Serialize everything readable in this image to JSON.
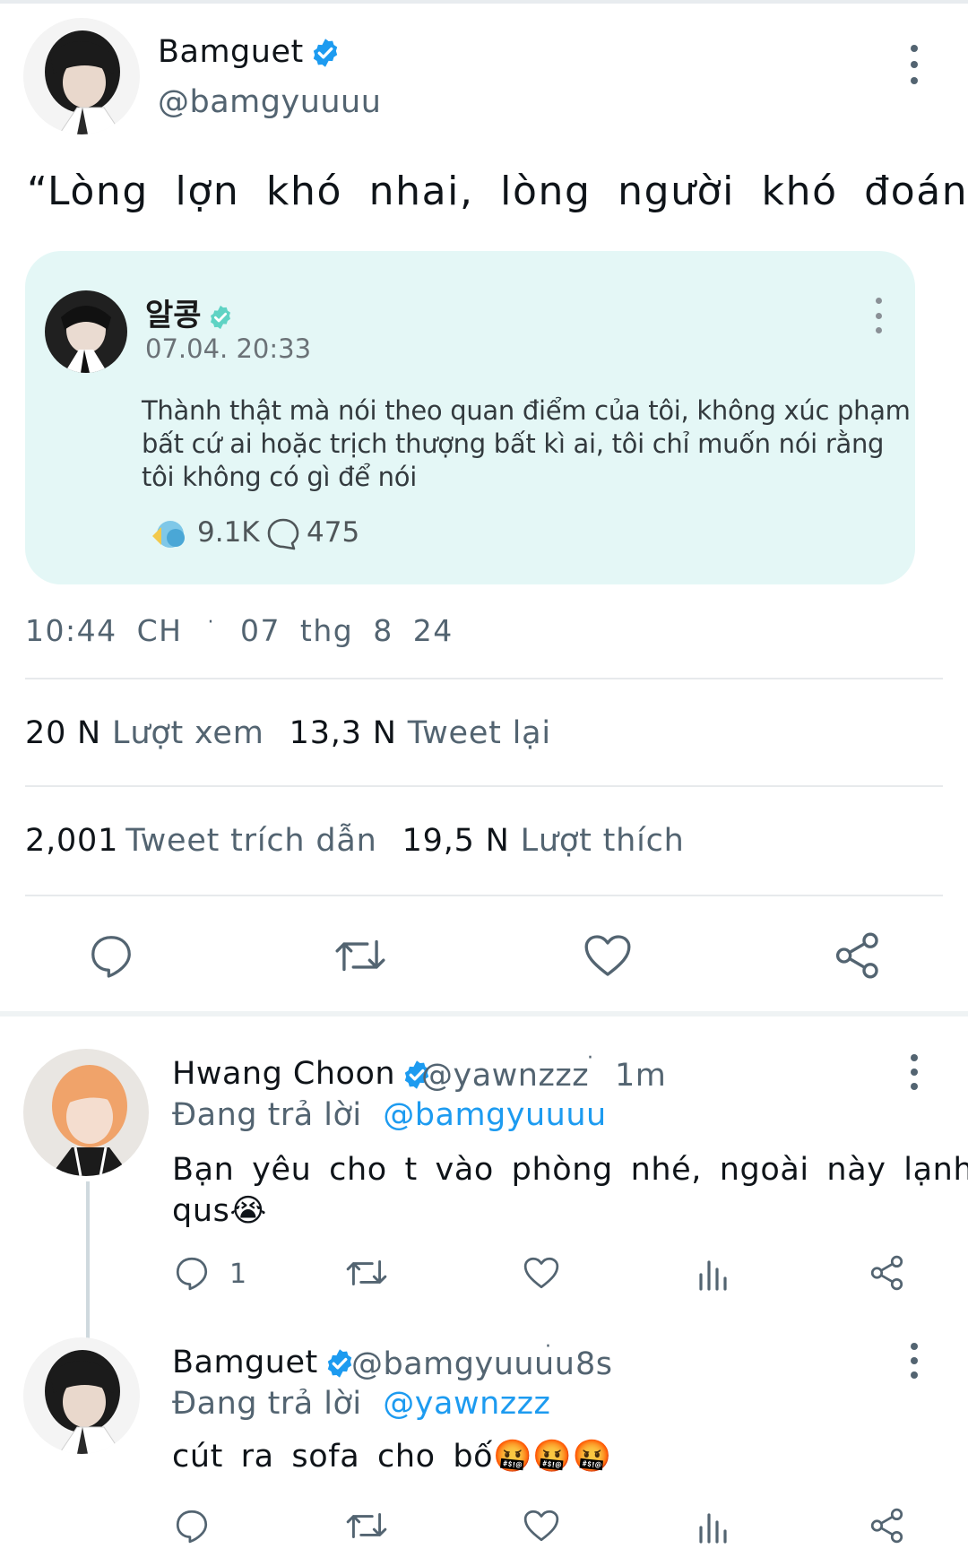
{
  "main_tweet": {
    "author_name": "Bamguet",
    "author_handle": "@bamgyuuuu",
    "text": "“Lòng lợn khó nhai, lòng người khó đoán”",
    "quoted": {
      "author_name": "알콩",
      "date": "07.04. 20:33",
      "body": "Thành thật mà nói theo quan điểm của tôi, không xúc phạm bất cứ ai hoặc trịch thượng bất kì ai, tôi chỉ muốn nói rằng tôi không có gì để nói",
      "likes": "9.1K",
      "comments": "475"
    },
    "time": "10:44 CH",
    "date": "07 thg 8 24",
    "views_count": "20 N",
    "views_label": "Lượt xem",
    "retweets_count": "13,3 N",
    "retweets_label": "Tweet lại",
    "quotes_count": "2,001",
    "quotes_label": "Tweet trích dẫn",
    "likes_count": "19,5 N",
    "likes_label": "Lượt thích"
  },
  "replies": [
    {
      "author_name": "Hwang Choon",
      "author_handle": "@yawnzzz",
      "time": "1m",
      "replying_prefix": "Đang trả lời",
      "replying_to": "@bamgyuuuu",
      "text_line1": "Bạn yêu cho t vào phòng nhé, ngoài này lạnh",
      "text_line2": "qus😭",
      "reply_count": "1"
    },
    {
      "author_name": "Bamguet",
      "author_handle": "@bamgyuuuu",
      "time": "8s",
      "replying_prefix": "Đang trả lời",
      "replying_to": "@yawnzzz",
      "text": "cút ra sofa cho bố🤬🤬🤬"
    }
  ],
  "icons": {
    "verified": "verified-badge-icon",
    "more": "more-vertical-icon",
    "reply": "reply-icon",
    "retweet": "retweet-icon",
    "like": "heart-icon",
    "share": "share-icon",
    "analytics": "analytics-icon"
  },
  "colors": {
    "accent": "#1d9bf0",
    "secondary_text": "#536471",
    "quote_bg": "#e4f7f6"
  }
}
